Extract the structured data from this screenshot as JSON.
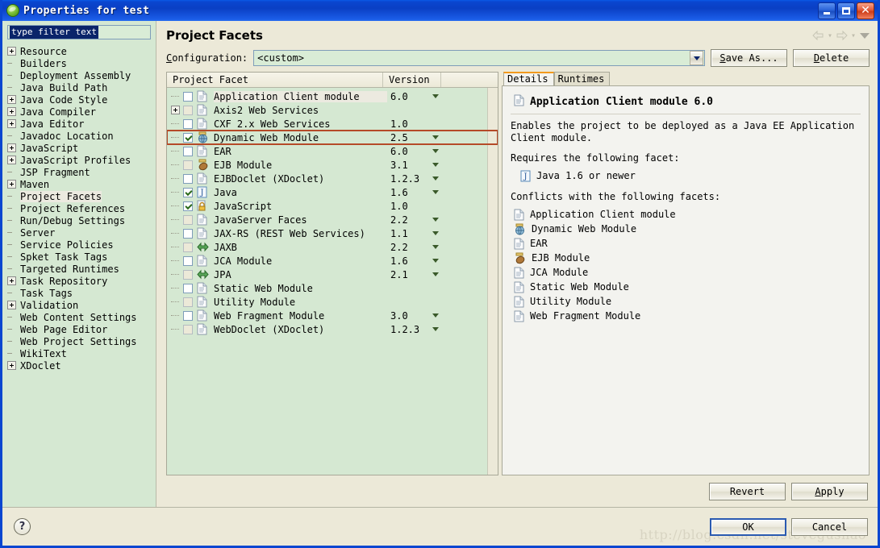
{
  "window": {
    "title": "Properties for test",
    "icon": "eclipse-globe-icon",
    "minimize_label": "Minimize",
    "maximize_label": "Maximize",
    "close_label": "Close"
  },
  "sidebar": {
    "filter_value": "type filter text",
    "filter_placeholder": "type filter text",
    "items": [
      {
        "label": "Resource",
        "expandable": true,
        "selected": false
      },
      {
        "label": "Builders",
        "expandable": false,
        "selected": false
      },
      {
        "label": "Deployment Assembly",
        "expandable": false,
        "selected": false
      },
      {
        "label": "Java Build Path",
        "expandable": false,
        "selected": false
      },
      {
        "label": "Java Code Style",
        "expandable": true,
        "selected": false
      },
      {
        "label": "Java Compiler",
        "expandable": true,
        "selected": false
      },
      {
        "label": "Java Editor",
        "expandable": true,
        "selected": false
      },
      {
        "label": "Javadoc Location",
        "expandable": false,
        "selected": false
      },
      {
        "label": "JavaScript",
        "expandable": true,
        "selected": false
      },
      {
        "label": "JavaScript Profiles",
        "expandable": true,
        "selected": false
      },
      {
        "label": "JSP Fragment",
        "expandable": false,
        "selected": false
      },
      {
        "label": "Maven",
        "expandable": true,
        "selected": false
      },
      {
        "label": "Project Facets",
        "expandable": false,
        "selected": true
      },
      {
        "label": "Project References",
        "expandable": false,
        "selected": false
      },
      {
        "label": "Run/Debug Settings",
        "expandable": false,
        "selected": false
      },
      {
        "label": "Server",
        "expandable": false,
        "selected": false
      },
      {
        "label": "Service Policies",
        "expandable": false,
        "selected": false
      },
      {
        "label": "Spket Task Tags",
        "expandable": false,
        "selected": false
      },
      {
        "label": "Targeted Runtimes",
        "expandable": false,
        "selected": false
      },
      {
        "label": "Task Repository",
        "expandable": true,
        "selected": false
      },
      {
        "label": "Task Tags",
        "expandable": false,
        "selected": false
      },
      {
        "label": "Validation",
        "expandable": true,
        "selected": false
      },
      {
        "label": "Web Content Settings",
        "expandable": false,
        "selected": false
      },
      {
        "label": "Web Page Editor",
        "expandable": false,
        "selected": false
      },
      {
        "label": "Web Project Settings",
        "expandable": false,
        "selected": false
      },
      {
        "label": "WikiText",
        "expandable": false,
        "selected": false
      },
      {
        "label": "XDoclet",
        "expandable": true,
        "selected": false
      }
    ]
  },
  "page": {
    "title": "Project Facets",
    "nav_back_icon": "back-arrow-icon",
    "nav_forward_icon": "forward-arrow-icon",
    "nav_menu_icon": "chevron-down-icon"
  },
  "configuration": {
    "label": "Configuration:",
    "label_mnemonic": "C",
    "value": "<custom>",
    "save_as_label": "Save As...",
    "save_as_mnemonic": "S",
    "delete_label": "Delete",
    "delete_mnemonic": "D"
  },
  "facet_table": {
    "columns": [
      "Project Facet",
      "Version",
      ""
    ],
    "rows": [
      {
        "name": "Application Client module",
        "version": "6.0",
        "checked": false,
        "expandable": false,
        "icon": "document-icon",
        "has_version_menu": true,
        "highlighted": true
      },
      {
        "name": "Axis2 Web Services",
        "version": "",
        "checked": false,
        "expandable": true,
        "icon": "document-icon",
        "has_version_menu": false,
        "highlighted": false
      },
      {
        "name": "CXF 2.x Web Services",
        "version": "1.0",
        "checked": false,
        "expandable": false,
        "icon": "document-icon",
        "has_version_menu": false,
        "highlighted": false
      },
      {
        "name": "Dynamic Web Module",
        "version": "2.5",
        "checked": true,
        "expandable": false,
        "icon": "globe-jar-icon",
        "has_version_menu": true,
        "highlighted": false,
        "outlined": true
      },
      {
        "name": "EAR",
        "version": "6.0",
        "checked": false,
        "expandable": false,
        "icon": "document-icon",
        "has_version_menu": true,
        "highlighted": false
      },
      {
        "name": "EJB Module",
        "version": "3.1",
        "checked": false,
        "expandable": false,
        "icon": "ejb-bean-icon",
        "has_version_menu": true,
        "highlighted": false
      },
      {
        "name": "EJBDoclet (XDoclet)",
        "version": "1.2.3",
        "checked": false,
        "expandable": false,
        "icon": "document-icon",
        "has_version_menu": true,
        "highlighted": false
      },
      {
        "name": "Java",
        "version": "1.6",
        "checked": true,
        "expandable": false,
        "icon": "java-icon",
        "has_version_menu": true,
        "highlighted": false
      },
      {
        "name": "JavaScript",
        "version": "1.0",
        "checked": true,
        "expandable": false,
        "icon": "lock-icon",
        "has_version_menu": false,
        "highlighted": false
      },
      {
        "name": "JavaServer Faces",
        "version": "2.2",
        "checked": false,
        "expandable": false,
        "icon": "document-icon",
        "has_version_menu": true,
        "highlighted": false
      },
      {
        "name": "JAX-RS (REST Web Services)",
        "version": "1.1",
        "checked": false,
        "expandable": false,
        "icon": "document-icon",
        "has_version_menu": true,
        "highlighted": false
      },
      {
        "name": "JAXB",
        "version": "2.2",
        "checked": false,
        "expandable": false,
        "icon": "arrows-icon",
        "has_version_menu": true,
        "highlighted": false
      },
      {
        "name": "JCA Module",
        "version": "1.6",
        "checked": false,
        "expandable": false,
        "icon": "document-icon",
        "has_version_menu": true,
        "highlighted": false
      },
      {
        "name": "JPA",
        "version": "2.1",
        "checked": false,
        "expandable": false,
        "icon": "arrows-icon",
        "has_version_menu": true,
        "highlighted": false
      },
      {
        "name": "Static Web Module",
        "version": "",
        "checked": false,
        "expandable": false,
        "icon": "document-icon",
        "has_version_menu": false,
        "highlighted": false
      },
      {
        "name": "Utility Module",
        "version": "",
        "checked": false,
        "expandable": false,
        "icon": "document-icon",
        "has_version_menu": false,
        "highlighted": false
      },
      {
        "name": "Web Fragment Module",
        "version": "3.0",
        "checked": false,
        "expandable": false,
        "icon": "document-icon",
        "has_version_menu": true,
        "highlighted": false
      },
      {
        "name": "WebDoclet (XDoclet)",
        "version": "1.2.3",
        "checked": false,
        "expandable": false,
        "icon": "document-icon",
        "has_version_menu": true,
        "highlighted": false
      }
    ]
  },
  "details": {
    "tabs": [
      {
        "label": "Details",
        "mnemonic": "t",
        "active": true
      },
      {
        "label": "Runtimes",
        "mnemonic": "R",
        "active": false
      }
    ],
    "heading": "Application Client module 6.0",
    "heading_icon": "document-icon",
    "description": "Enables the project to be deployed as a Java EE Application Client module.",
    "requires_label": "Requires the following facet:",
    "requires": [
      {
        "label": "Java 1.6 or newer",
        "icon": "java-icon"
      }
    ],
    "conflicts_label": "Conflicts with the following facets:",
    "conflicts": [
      {
        "label": "Application Client module",
        "icon": "document-icon"
      },
      {
        "label": "Dynamic Web Module",
        "icon": "globe-jar-icon"
      },
      {
        "label": "EAR",
        "icon": "document-icon"
      },
      {
        "label": "EJB Module",
        "icon": "ejb-bean-icon"
      },
      {
        "label": "JCA Module",
        "icon": "document-icon"
      },
      {
        "label": "Static Web Module",
        "icon": "document-icon"
      },
      {
        "label": "Utility Module",
        "icon": "document-icon"
      },
      {
        "label": "Web Fragment Module",
        "icon": "document-icon"
      }
    ]
  },
  "actions": {
    "revert_label": "Revert",
    "apply_label": "Apply",
    "apply_mnemonic": "A",
    "ok_label": "OK",
    "cancel_label": "Cancel",
    "help_icon": "question-mark-icon"
  },
  "watermark": "http://blog.csdn.net/stevegushao",
  "colors": {
    "titlebar": "#0a3fc4",
    "form_bg": "#ece9d8",
    "tree_bg": "#d5e8d2",
    "details_bg": "#f3f3ef",
    "selection_outline": "#b54a28",
    "active_tab_accent": "#f29a1e",
    "text_selection": "#0a246a"
  }
}
